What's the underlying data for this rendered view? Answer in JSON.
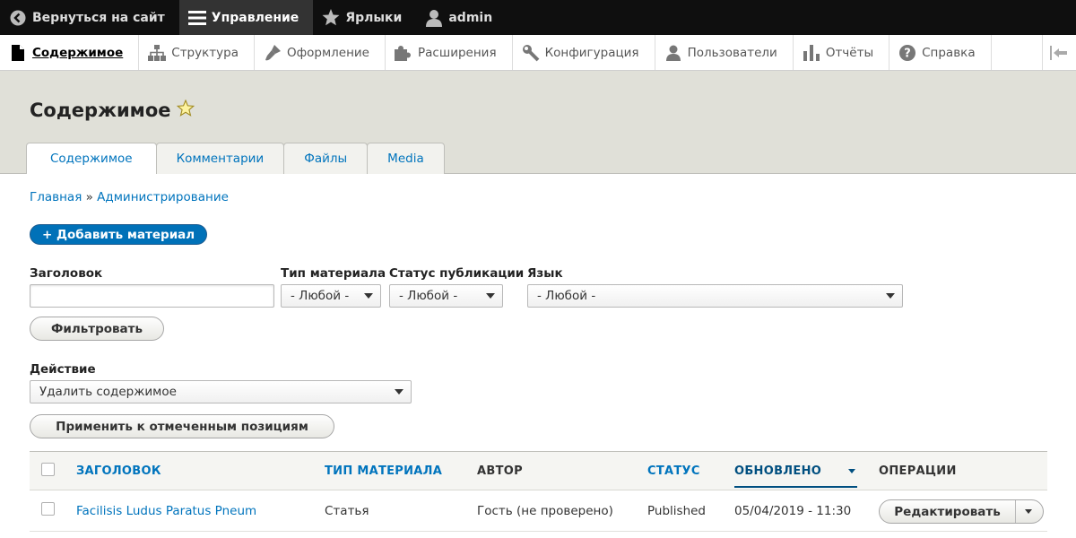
{
  "colors": {
    "toolbar_bg": "#0f0f0f",
    "header_bg": "#e0e0d8",
    "link": "#0074bd",
    "primary": "#0071b8"
  },
  "toolbar": {
    "back": {
      "label": "Вернуться на сайт",
      "icon": "back-arrow-icon"
    },
    "manage": {
      "label": "Управление",
      "icon": "hamburger-icon"
    },
    "shortcuts": {
      "label": "Ярлыки",
      "icon": "star-icon"
    },
    "user": {
      "label": "admin",
      "icon": "user-icon"
    }
  },
  "tray": {
    "items": [
      {
        "label": "Содержимое",
        "icon": "file-icon"
      },
      {
        "label": "Структура",
        "icon": "sitemap-icon"
      },
      {
        "label": "Оформление",
        "icon": "paintbrush-icon"
      },
      {
        "label": "Расширения",
        "icon": "puzzle-icon"
      },
      {
        "label": "Конфигурация",
        "icon": "wrench-icon"
      },
      {
        "label": "Пользователи",
        "icon": "people-icon"
      },
      {
        "label": "Отчёты",
        "icon": "bar-chart-icon"
      },
      {
        "label": "Справка",
        "icon": "help-icon"
      }
    ]
  },
  "page": {
    "title": "Содержимое"
  },
  "tabs": [
    "Содержимое",
    "Комментарии",
    "Файлы",
    "Media"
  ],
  "breadcrumb": {
    "home": "Главная",
    "sep": "»",
    "admin": "Администрирование"
  },
  "add_button": "+ Добавить материал",
  "filters": {
    "title_label": "Заголовок",
    "title_value": "",
    "type_label": "Тип материала",
    "type_value": "- Любой -",
    "status_label": "Статус публикации",
    "status_value": "- Любой -",
    "lang_label": "Язык",
    "lang_value": "- Любой -",
    "submit": "Фильтровать"
  },
  "action": {
    "label": "Действие",
    "value": "Удалить содержимое",
    "apply": "Применить к отмеченным позициям"
  },
  "table": {
    "headers": {
      "title": "ЗАГОЛОВОК",
      "type": "ТИП МАТЕРИАЛА",
      "author": "АВТОР",
      "status": "СТАТУС",
      "updated": "ОБНОВЛЕНО",
      "operations": "ОПЕРАЦИИ"
    },
    "rows": [
      {
        "title": "Facilisis Ludus Paratus Pneum",
        "type": "Статья",
        "author": "Гость (не проверено)",
        "status": "Published",
        "updated": "05/04/2019 - 11:30",
        "operation": "Редактировать"
      }
    ]
  }
}
